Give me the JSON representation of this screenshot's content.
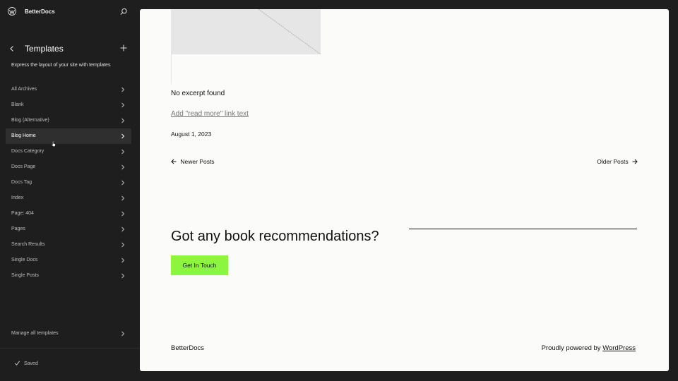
{
  "sidebar": {
    "site_name": "BetterDocs",
    "panel_title": "Templates",
    "panel_description": "Express the layout of your site with templates",
    "items": [
      {
        "label": "All Archives"
      },
      {
        "label": "Blank"
      },
      {
        "label": "Blog (Alternative)"
      },
      {
        "label": "Blog Home",
        "active": true
      },
      {
        "label": "Docs Category"
      },
      {
        "label": "Docs Page"
      },
      {
        "label": "Docs Tag"
      },
      {
        "label": "Index"
      },
      {
        "label": "Page: 404"
      },
      {
        "label": "Pages"
      },
      {
        "label": "Search Results"
      },
      {
        "label": "Single Docs"
      },
      {
        "label": "Single Posts"
      }
    ],
    "manage_label": "Manage all templates",
    "saved_label": "Saved"
  },
  "canvas": {
    "excerpt": "No excerpt found",
    "read_more": "Add \"read more\" link text",
    "date": "August 1, 2023",
    "newer": "Newer Posts",
    "older": "Older Posts",
    "cta_heading": "Got any book recommendations?",
    "cta_button": "Get In Touch",
    "footer_name": "BetterDocs",
    "footer_powered": "Proudly powered by",
    "footer_link": "WordPress"
  },
  "colors": {
    "sidebar_bg": "#1e1e1e",
    "canvas_bg": "#fbfbf9",
    "cta_button": "#8cf53f",
    "active_item": "#2f2f2f"
  },
  "icons": [
    "wordpress-logo-icon",
    "search-icon",
    "chevron-left-icon",
    "plus-icon",
    "chevron-right-icon",
    "check-icon",
    "arrow-left-icon",
    "arrow-right-icon"
  ]
}
